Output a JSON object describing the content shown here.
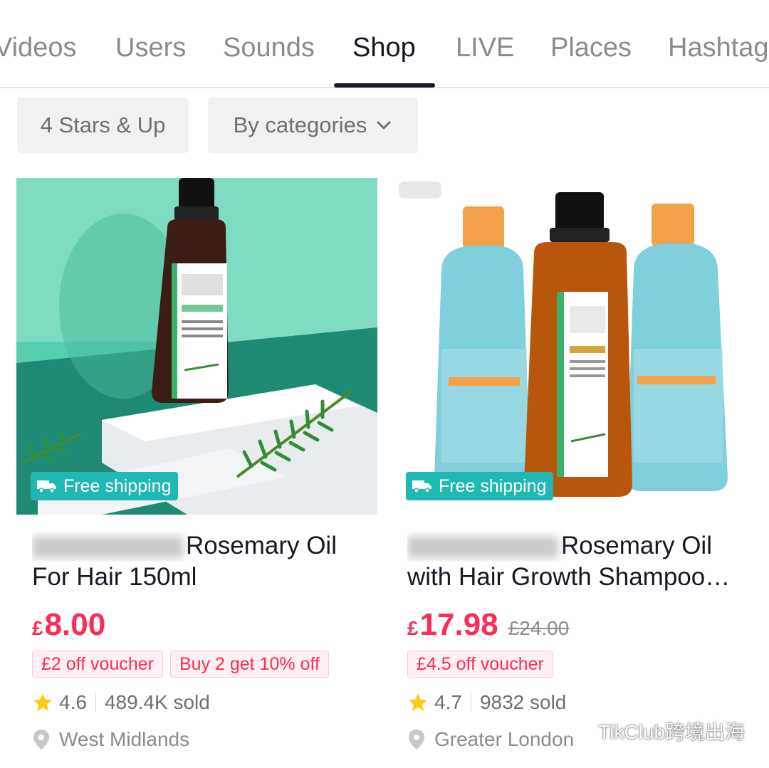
{
  "tabs": [
    {
      "label": "Videos"
    },
    {
      "label": "Users"
    },
    {
      "label": "Sounds"
    },
    {
      "label": "Shop"
    },
    {
      "label": "LIVE"
    },
    {
      "label": "Places"
    },
    {
      "label": "Hashtag"
    }
  ],
  "active_tab": "Shop",
  "filters": {
    "rating_label": "4 Stars & Up",
    "category_label": "By categories"
  },
  "products": [
    {
      "badge": "Free shipping",
      "title_line1": "Rosemary Oil",
      "title_line2": "For Hair 150ml",
      "currency": "£",
      "price": "8.00",
      "old_price": "",
      "vouchers": [
        "£2 off voucher",
        "Buy 2 get 10% off"
      ],
      "rating": "4.6",
      "sold": "489.4K sold",
      "location": "West Midlands"
    },
    {
      "badge": "Free shipping",
      "title_line1": "Rosemary Oil",
      "title_line2": "with Hair Growth Shampoo…",
      "currency": "£",
      "price": "17.98",
      "old_price": "£24.00",
      "vouchers": [
        "£4.5 off voucher"
      ],
      "rating": "4.7",
      "sold": "9832 sold",
      "location": "Greater London"
    }
  ],
  "watermark": "TikClub跨境出海",
  "colors": {
    "accent": "#fe2c55",
    "badge": "#20b8b2",
    "star": "#facc15"
  }
}
